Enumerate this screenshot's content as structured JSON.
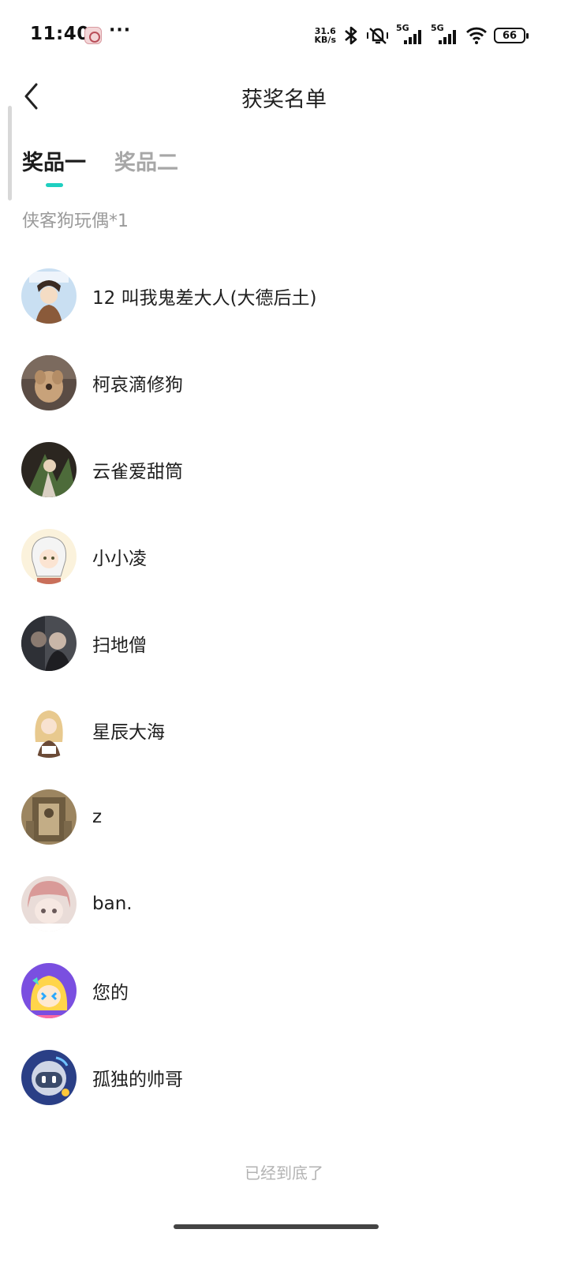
{
  "status_bar": {
    "time": "11:40",
    "net_speed_value": "31.6",
    "net_speed_unit": "KB/s",
    "signal_label_1": "5G",
    "signal_label_2": "5G",
    "battery": "66",
    "icons": [
      "app-notification-icon",
      "more-dots-icon",
      "bluetooth-icon",
      "silent-vibrate-icon",
      "signal-icon",
      "wifi-icon",
      "battery-icon"
    ]
  },
  "header": {
    "title": "获奖名单"
  },
  "tabs": [
    {
      "label": "奖品一",
      "active": true
    },
    {
      "label": "奖品二",
      "active": false
    }
  ],
  "prize": {
    "name": "侠客狗玩偶*1"
  },
  "winners": [
    {
      "name": "12 叫我鬼差大人(大德后土)",
      "avatar": "anime-character-avatar"
    },
    {
      "name": "柯哀滴修狗",
      "avatar": "plush-dog-avatar"
    },
    {
      "name": "云雀爱甜筒",
      "avatar": "game-character-avatar"
    },
    {
      "name": "小小凌",
      "avatar": "white-hair-girl-avatar"
    },
    {
      "name": "扫地僧",
      "avatar": "photo-avatar"
    },
    {
      "name": "星辰大海",
      "avatar": "blonde-girl-avatar"
    },
    {
      "name": "z",
      "avatar": "temple-avatar"
    },
    {
      "name": "ban.",
      "avatar": "pink-hair-girl-avatar"
    },
    {
      "name": "您的",
      "avatar": "cartoon-avatar"
    },
    {
      "name": "孤独的帅哥",
      "avatar": "robot-avatar"
    }
  ],
  "footer": {
    "end_text": "已经到底了"
  },
  "colors": {
    "accent": "#1fcfc0",
    "inactive_tab": "#a7a7a7",
    "secondary_text": "#9a9a9a"
  }
}
